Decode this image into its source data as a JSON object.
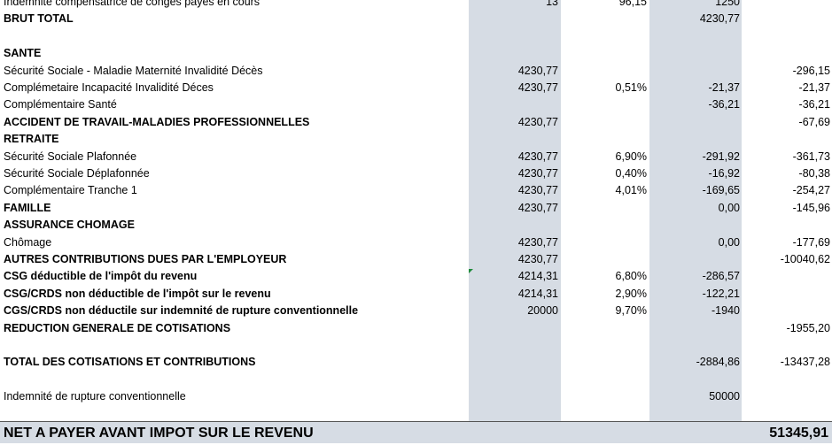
{
  "rows": [
    {
      "label": "Indemnité compensatrice de congés payés en cours",
      "base": "13",
      "rate": "96,15",
      "employee": "1250",
      "employer": "",
      "bold": false
    },
    {
      "label": "BRUT TOTAL",
      "base": "",
      "rate": "",
      "employee": "4230,77",
      "employer": "",
      "bold": true
    },
    {
      "label": "",
      "base": "",
      "rate": "",
      "employee": "",
      "employer": "",
      "bold": false
    },
    {
      "label": "SANTE",
      "base": "",
      "rate": "",
      "employee": "",
      "employer": "",
      "bold": true
    },
    {
      "label": "Sécurité Sociale - Maladie Maternité Invalidité Décès",
      "base": "4230,77",
      "rate": "",
      "employee": "",
      "employer": "-296,15",
      "bold": false
    },
    {
      "label": "Complémetaire Incapacité Invalidité Déces",
      "base": "4230,77",
      "rate": "0,51%",
      "employee": "-21,37",
      "employer": "-21,37",
      "bold": false
    },
    {
      "label": "Complémentaire Santé",
      "base": "",
      "rate": "",
      "employee": "-36,21",
      "employer": "-36,21",
      "bold": false
    },
    {
      "label": "ACCIDENT DE TRAVAIL-MALADIES PROFESSIONNELLES",
      "base": "4230,77",
      "rate": "",
      "employee": "",
      "employer": "-67,69",
      "bold": true
    },
    {
      "label": "RETRAITE",
      "base": "",
      "rate": "",
      "employee": "",
      "employer": "",
      "bold": true
    },
    {
      "label": "Sécurité Sociale Plafonnée",
      "base": "4230,77",
      "rate": "6,90%",
      "employee": "-291,92",
      "employer": "-361,73",
      "bold": false
    },
    {
      "label": "Sécurité Sociale Déplafonnée",
      "base": "4230,77",
      "rate": "0,40%",
      "employee": "-16,92",
      "employer": "-80,38",
      "bold": false
    },
    {
      "label": "Complémentaire Tranche 1",
      "base": "4230,77",
      "rate": "4,01%",
      "employee": "-169,65",
      "employer": "-254,27",
      "bold": false
    },
    {
      "label": "FAMILLE",
      "base": "4230,77",
      "rate": "",
      "employee": "0,00",
      "employer": "-145,96",
      "bold": true
    },
    {
      "label": "ASSURANCE CHOMAGE",
      "base": "",
      "rate": "",
      "employee": "",
      "employer": "",
      "bold": true
    },
    {
      "label": "Chômage",
      "base": "4230,77",
      "rate": "",
      "employee": "0,00",
      "employer": "-177,69",
      "bold": false
    },
    {
      "label": "AUTRES CONTRIBUTIONS DUES PAR L'EMPLOYEUR",
      "base": "4230,77",
      "rate": "",
      "employee": "",
      "employer": "-10040,62",
      "bold": true
    },
    {
      "label": "CSG déductible de l'impôt du revenu",
      "base": "4214,31",
      "rate": "6,80%",
      "employee": "-286,57",
      "employer": "",
      "bold": true
    },
    {
      "label": "CSG/CRDS non déductible de l'impôt sur le revenu",
      "base": "4214,31",
      "rate": "2,90%",
      "employee": "-122,21",
      "employer": "",
      "bold": true
    },
    {
      "label": "CGS/CRDS non déductile sur indemnité de rupture conventionnelle",
      "base": "20000",
      "rate": "9,70%",
      "employee": "-1940",
      "employer": "",
      "bold": true
    },
    {
      "label": "REDUCTION GENERALE DE COTISATIONS",
      "base": "",
      "rate": "",
      "employee": "",
      "employer": "-1955,20",
      "bold": true
    },
    {
      "label": "",
      "base": "",
      "rate": "",
      "employee": "",
      "employer": "",
      "bold": false
    },
    {
      "label": "TOTAL DES COTISATIONS ET CONTRIBUTIONS",
      "base": "",
      "rate": "",
      "employee": "-2884,86",
      "employer": "-13437,28",
      "bold": true
    },
    {
      "label": "",
      "base": "",
      "rate": "",
      "employee": "",
      "employer": "",
      "bold": false
    },
    {
      "label": "Indemnité de rupture conventionnelle",
      "base": "",
      "rate": "",
      "employee": "50000",
      "employer": "",
      "bold": false
    }
  ],
  "footer": {
    "label": "NET A PAYER AVANT IMPOT SUR LE REVENU",
    "amount": "51345,91"
  },
  "colors": {
    "shade": "#d6dce4",
    "marker": "#1e8a3a"
  }
}
